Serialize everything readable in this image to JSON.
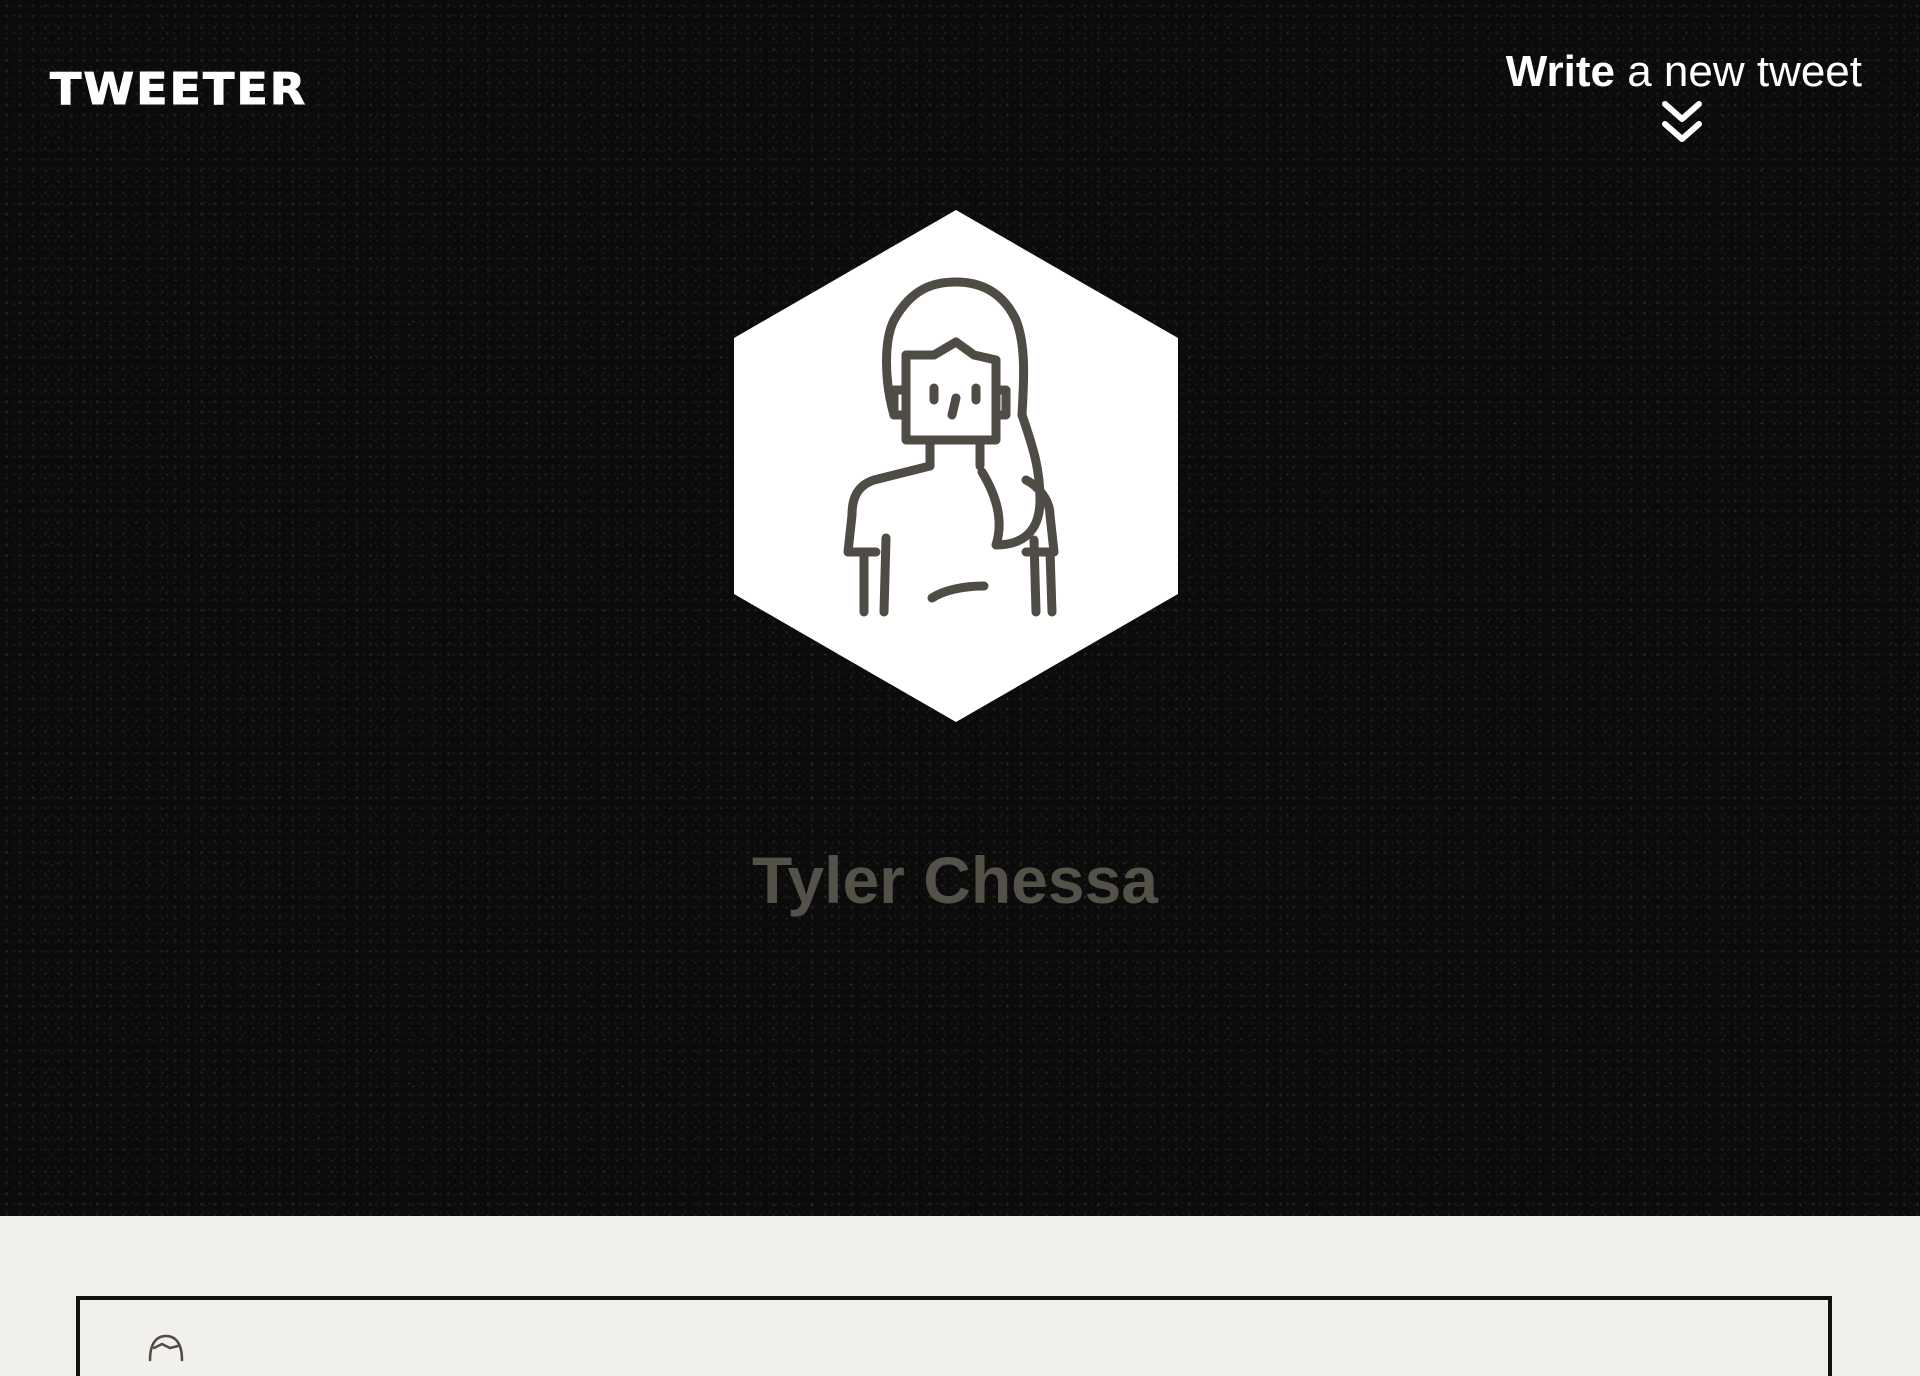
{
  "header": {
    "brand": "TWEETER",
    "compose": {
      "strong": "Write",
      "rest": " a new tweet"
    },
    "compose_icon": "double-chevron-down-icon"
  },
  "profile": {
    "name": "Tyler Chessa",
    "avatar_icon": "woman-avatar-icon"
  },
  "feed": {
    "first_card_avatar_icon": "avatar-icon"
  },
  "colors": {
    "hero_background": "#0b0b0b",
    "page_background": "#f1f0eb",
    "name_text": "#545149",
    "avatar_stroke": "#4f4c45",
    "hexagon_fill": "#ffffff"
  }
}
